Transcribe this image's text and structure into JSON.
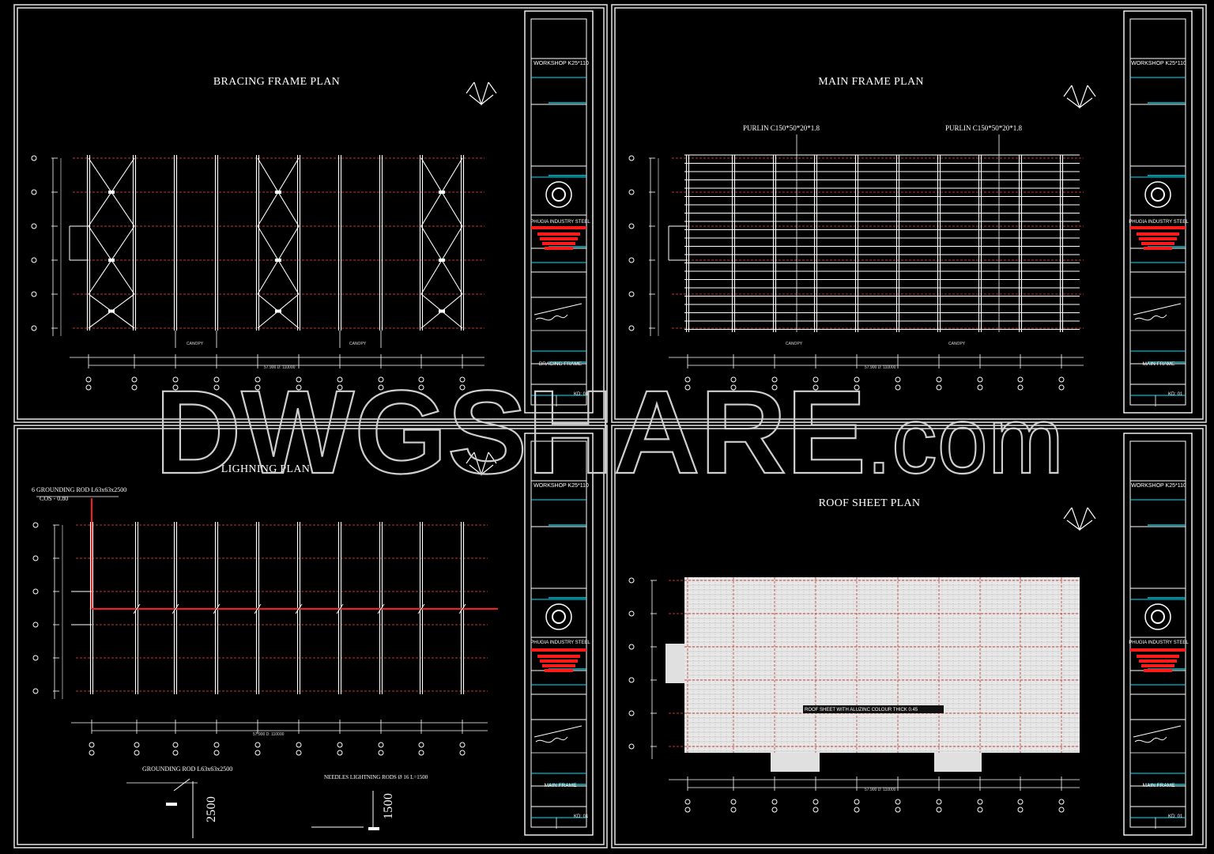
{
  "sheets": [
    {
      "id": "bracing",
      "title": "BRACING FRAME PLAN",
      "titleblock_project": "WORKSHOP K25*110",
      "company": "PHUGIA INDUSTRY STEEL",
      "drawing_name": "BRACING FRAME",
      "sheet_no": "KD: 01",
      "canopy_labels": [
        "CANOPY",
        "CANOPY"
      ],
      "dimension_total": "57.900 D: 110000"
    },
    {
      "id": "mainframe",
      "title": "MAIN FRAME PLAN",
      "titleblock_project": "WORKSHOP K25*110",
      "company": "PHUGIA INDUSTRY STEEL",
      "drawing_name": "MAIN FRAME",
      "sheet_no": "KD: 01",
      "purlin_labels": [
        "PURLIN C150*50*20*1.8",
        "PURLIN C150*50*20*1.8"
      ],
      "canopy_labels": [
        "CANOPY",
        "CANOPY"
      ],
      "dimension_total": "57.900 D: 110000"
    },
    {
      "id": "lightning",
      "title": "LIGHNING PLAN",
      "titleblock_project": "WORKSHOP K25*110",
      "company": "PHUGIA INDUSTRY STEEL",
      "drawing_name": "MAIN FRAME",
      "sheet_no": "KD: 01",
      "grounding_note_1": "6 GROUNDING ROD L63x63x2500",
      "grounding_note_2": "COS - 0.80",
      "grounding_rod_label": "GROUNDING ROD L63x63x2500",
      "needles_label": "NEEDLES LIGHTNING RODS Ø 16 L=1500",
      "detail_dim_1": "2500",
      "detail_dim_2": "1500",
      "dimension_total": "57.900 D: 110000"
    },
    {
      "id": "roof",
      "title": "ROOF SHEET PLAN",
      "titleblock_project": "WORKSHOP K25*110",
      "company": "PHUGIA INDUSTRY STEEL",
      "drawing_name": "MAIN FRAME",
      "sheet_no": "KD: 01",
      "roof_note": "ROOF SHEET WITH ALUZINC COLOUR THICK 0.45",
      "dimension_total": "57.900 D: 110000"
    }
  ],
  "watermark": {
    "main": "DWGSHARE",
    "suffix": ".com"
  },
  "colors": {
    "frame": "#d8d8d8",
    "grid_red": "#c0392b",
    "accent_red": "#ff1a1a",
    "cyan": "#00e5ff",
    "purlin": "#ffffff"
  },
  "logo_text": "PHUGIA"
}
